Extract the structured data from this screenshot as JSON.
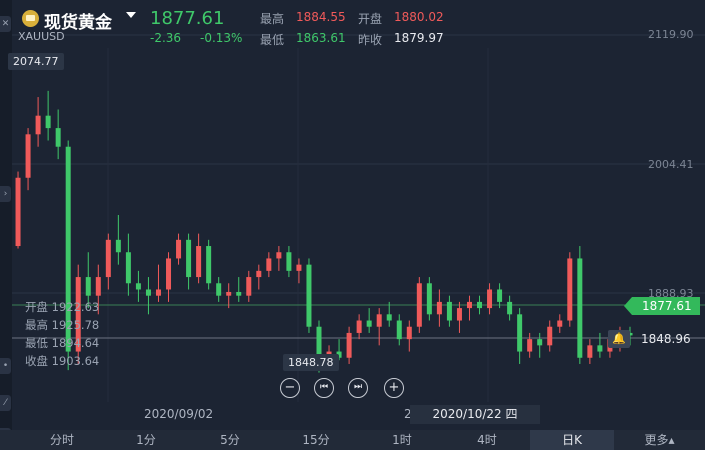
{
  "header": {
    "title": "现货黄金",
    "symbol": "XAUUSD",
    "price": "1877.61",
    "change": "-2.36",
    "change_pct": "-0.13%",
    "high_label": "最高",
    "high_value": "1884.55",
    "open_label": "开盘",
    "open_value": "1880.02",
    "low_label": "最低",
    "low_value": "1863.61",
    "prev_close_label": "昨收",
    "prev_close_value": "1879.97"
  },
  "axis": {
    "ticks": [
      "2119.90",
      "2004.41",
      "1888.93"
    ],
    "max_marker": "2074.77",
    "min_marker": "1848.78",
    "current_price_tag": "1877.61",
    "crosshair_price": "1848.96"
  },
  "ohlc_panel": {
    "open_label": "开盘",
    "open_value": "1922.63",
    "high_label": "最高",
    "high_value": "1925.78",
    "low_label": "最低",
    "low_value": "1894.64",
    "close_label": "收盘",
    "close_value": "1903.64"
  },
  "dates": {
    "left": "2020/09/02",
    "partial": "2",
    "highlighted": "2020/10/22 四"
  },
  "controls": {
    "zoom_out": "−",
    "prev": "⏮",
    "next": "⏭",
    "zoom_in": "+"
  },
  "tabs": [
    "分时",
    "1分",
    "5分",
    "15分",
    "1时",
    "4时",
    "日K",
    "更多▴"
  ],
  "active_tab": "日K",
  "colors": {
    "up": "#f05a5a",
    "down": "#3fc86a",
    "background": "#1c2433"
  },
  "chart_data": {
    "type": "candlestick",
    "ylim": [
      1830,
      2120
    ],
    "candles": [
      [
        1980,
        1985,
        1945,
        1950
      ],
      [
        1950,
        2010,
        1948,
        2005
      ],
      [
        2005,
        2045,
        1995,
        2040
      ],
      [
        2040,
        2070,
        2030,
        2055
      ],
      [
        2055,
        2075,
        2035,
        2045
      ],
      [
        2045,
        2060,
        2020,
        2030
      ],
      [
        2030,
        2035,
        1850,
        1865
      ],
      [
        1865,
        1935,
        1855,
        1925
      ],
      [
        1925,
        1945,
        1900,
        1910
      ],
      [
        1910,
        1935,
        1895,
        1925
      ],
      [
        1925,
        1960,
        1915,
        1955
      ],
      [
        1955,
        1975,
        1935,
        1945
      ],
      [
        1945,
        1960,
        1910,
        1920
      ],
      [
        1920,
        1930,
        1905,
        1915
      ],
      [
        1915,
        1925,
        1895,
        1910
      ],
      [
        1910,
        1935,
        1905,
        1915
      ],
      [
        1915,
        1945,
        1905,
        1940
      ],
      [
        1940,
        1960,
        1935,
        1955
      ],
      [
        1955,
        1960,
        1915,
        1925
      ],
      [
        1925,
        1960,
        1920,
        1950
      ],
      [
        1950,
        1955,
        1915,
        1920
      ],
      [
        1920,
        1925,
        1905,
        1910
      ],
      [
        1910,
        1920,
        1900,
        1913
      ],
      [
        1913,
        1925,
        1905,
        1910
      ],
      [
        1910,
        1930,
        1905,
        1925
      ],
      [
        1925,
        1935,
        1915,
        1930
      ],
      [
        1930,
        1945,
        1925,
        1940
      ],
      [
        1940,
        1950,
        1930,
        1945
      ],
      [
        1945,
        1950,
        1925,
        1930
      ],
      [
        1930,
        1940,
        1920,
        1935
      ],
      [
        1935,
        1940,
        1880,
        1885
      ],
      [
        1885,
        1890,
        1848,
        1860
      ],
      [
        1860,
        1870,
        1850,
        1865
      ],
      [
        1865,
        1875,
        1858,
        1860
      ],
      [
        1860,
        1885,
        1855,
        1880
      ],
      [
        1880,
        1895,
        1875,
        1890
      ],
      [
        1890,
        1900,
        1880,
        1885
      ],
      [
        1885,
        1900,
        1870,
        1895
      ],
      [
        1895,
        1905,
        1885,
        1890
      ],
      [
        1890,
        1895,
        1870,
        1875
      ],
      [
        1875,
        1890,
        1865,
        1885
      ],
      [
        1885,
        1925,
        1880,
        1920
      ],
      [
        1920,
        1925,
        1890,
        1895
      ],
      [
        1895,
        1915,
        1885,
        1905
      ],
      [
        1905,
        1910,
        1885,
        1890
      ],
      [
        1890,
        1905,
        1880,
        1900
      ],
      [
        1900,
        1910,
        1890,
        1905
      ],
      [
        1905,
        1910,
        1895,
        1900
      ],
      [
        1900,
        1920,
        1895,
        1915
      ],
      [
        1915,
        1920,
        1900,
        1905
      ],
      [
        1905,
        1910,
        1890,
        1895
      ],
      [
        1895,
        1900,
        1855,
        1865
      ],
      [
        1865,
        1880,
        1860,
        1875
      ],
      [
        1875,
        1880,
        1860,
        1870
      ],
      [
        1870,
        1890,
        1865,
        1885
      ],
      [
        1885,
        1895,
        1880,
        1890
      ],
      [
        1890,
        1945,
        1885,
        1940
      ],
      [
        1940,
        1950,
        1855,
        1860
      ],
      [
        1860,
        1875,
        1855,
        1870
      ],
      [
        1870,
        1880,
        1860,
        1865
      ],
      [
        1865,
        1880,
        1860,
        1875
      ],
      [
        1875,
        1885,
        1865,
        1880
      ],
      [
        1880,
        1885,
        1870,
        1878
      ]
    ]
  }
}
